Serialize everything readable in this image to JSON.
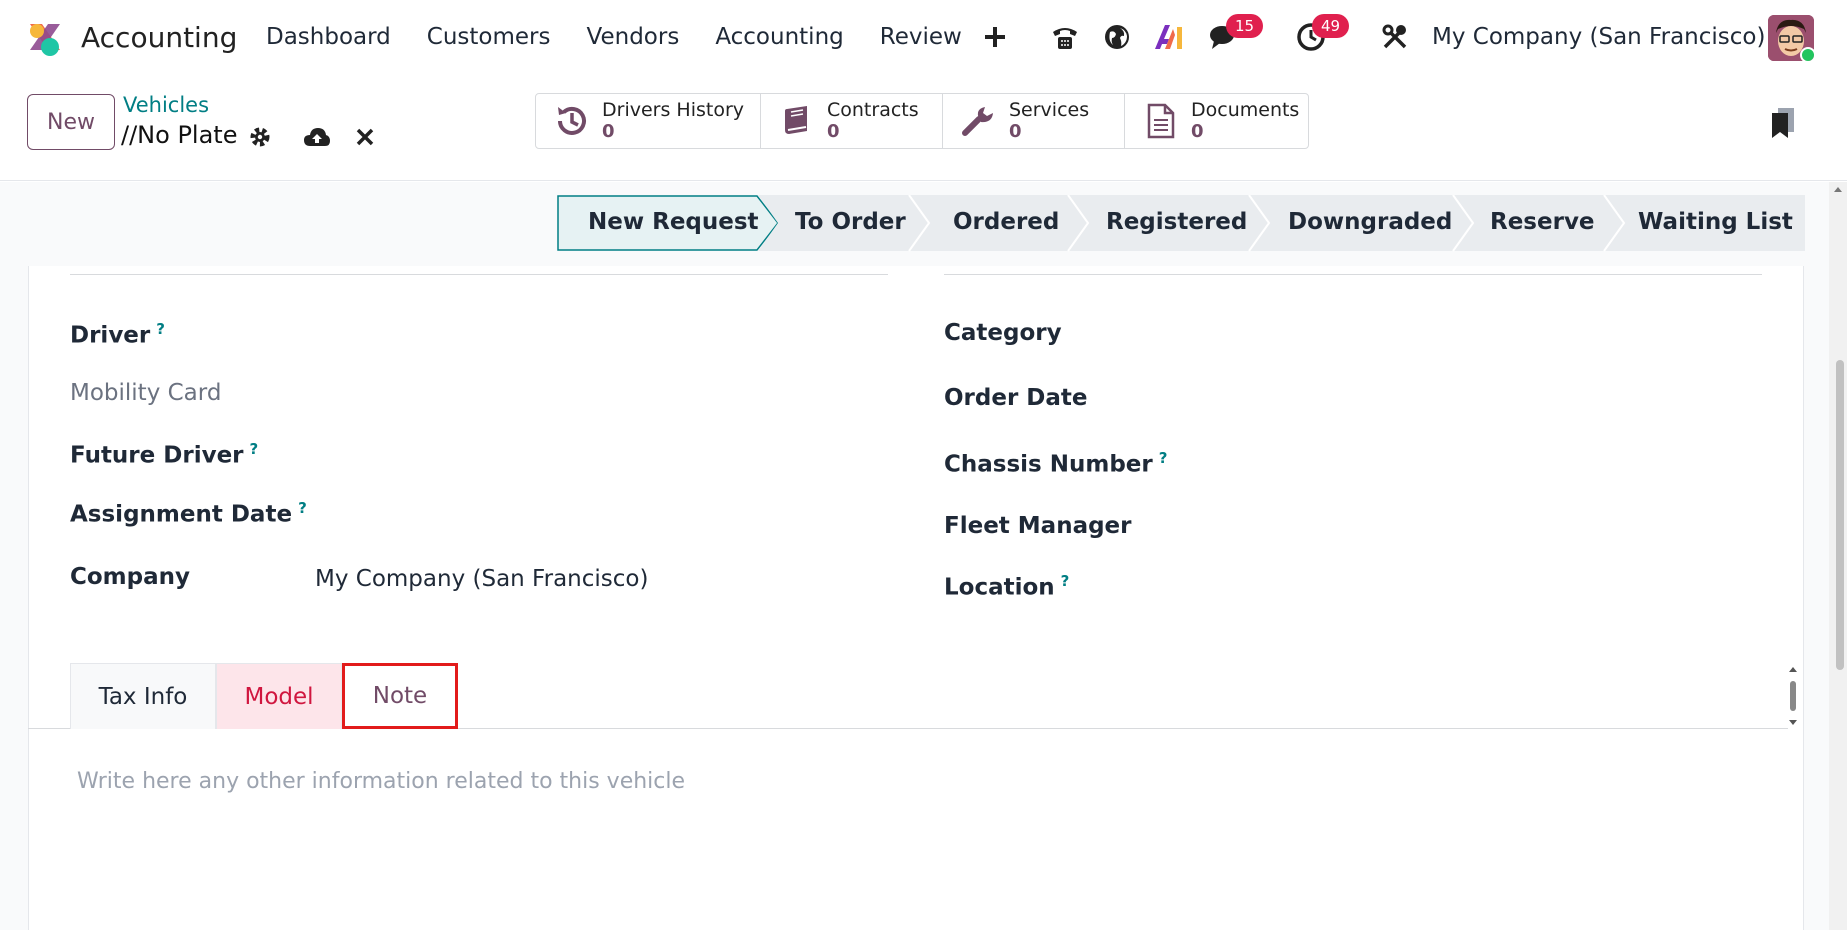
{
  "navbar": {
    "app_name": "Accounting",
    "menu": [
      "Dashboard",
      "Customers",
      "Vendors",
      "Accounting",
      "Review"
    ],
    "plus_label": "+",
    "messages_badge": "15",
    "activities_badge": "49",
    "company": "My Company (San Francisco)",
    "icons": [
      "plus-icon",
      "phone-icon",
      "globe-icon",
      "ai-icon",
      "chat-icon",
      "clock-icon",
      "tools-icon"
    ]
  },
  "control": {
    "new_label": "New",
    "breadcrumb_parent": "Vehicles",
    "breadcrumb_current": "//No Plate",
    "smart_buttons": [
      {
        "label": "Drivers History",
        "count": "0",
        "icon": "history-icon"
      },
      {
        "label": "Contracts",
        "count": "0",
        "icon": "book-icon"
      },
      {
        "label": "Services",
        "count": "0",
        "icon": "wrench-icon"
      },
      {
        "label": "Documents",
        "count": "0",
        "icon": "document-icon"
      }
    ]
  },
  "statusbar": {
    "stages": [
      "New Request",
      "To Order",
      "Ordered",
      "Registered",
      "Downgraded",
      "Reserve",
      "Waiting List"
    ],
    "active": "New Request"
  },
  "form": {
    "left": {
      "driver": "Driver",
      "mobility_card": "Mobility Card",
      "future_driver": "Future Driver",
      "assignment_date": "Assignment Date",
      "company": "Company",
      "company_value": "My Company (San Francisco)"
    },
    "right": {
      "category": "Category",
      "order_date": "Order Date",
      "chassis_number": "Chassis Number",
      "fleet_manager": "Fleet Manager",
      "location": "Location"
    },
    "help_mark": "?"
  },
  "tabs": {
    "items": [
      "Tax Info",
      "Model",
      "Note"
    ],
    "active": "Note",
    "note_placeholder": "Write here any other information related to this vehicle"
  },
  "colors": {
    "brand": "#714b67",
    "link": "#017e84",
    "badge": "#e0204e",
    "highlight": "#e21b1b"
  }
}
